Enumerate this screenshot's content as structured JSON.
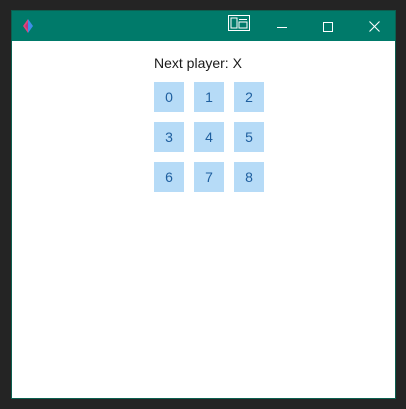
{
  "window": {
    "titlebar_color": "#007a6a",
    "app_icon": "diamond-logo-icon",
    "controls": {
      "overlay_icon": "compact-overlay-icon",
      "minimize_icon": "minimize-icon",
      "maximize_icon": "maximize-icon",
      "close_icon": "close-icon"
    }
  },
  "game": {
    "status_text": "Next player: X",
    "cells": [
      "0",
      "1",
      "2",
      "3",
      "4",
      "5",
      "6",
      "7",
      "8"
    ],
    "cell_color": "#b6dbf7",
    "cell_text_color": "#1f5f9f"
  }
}
